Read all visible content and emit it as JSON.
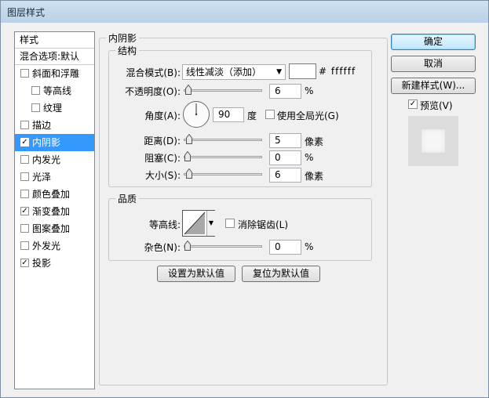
{
  "window": {
    "title": "图层样式"
  },
  "sidebar": {
    "header": "样式",
    "blend_options": "混合选项:默认",
    "items": [
      {
        "label": "斜面和浮雕",
        "checked": false,
        "indent": 0
      },
      {
        "label": "等高线",
        "checked": false,
        "indent": 1
      },
      {
        "label": "纹理",
        "checked": false,
        "indent": 1
      },
      {
        "label": "描边",
        "checked": false,
        "indent": 0
      },
      {
        "label": "内阴影",
        "checked": true,
        "indent": 0,
        "selected": true
      },
      {
        "label": "内发光",
        "checked": false,
        "indent": 0
      },
      {
        "label": "光泽",
        "checked": false,
        "indent": 0
      },
      {
        "label": "颜色叠加",
        "checked": false,
        "indent": 0
      },
      {
        "label": "渐变叠加",
        "checked": true,
        "indent": 0
      },
      {
        "label": "图案叠加",
        "checked": false,
        "indent": 0
      },
      {
        "label": "外发光",
        "checked": false,
        "indent": 0
      },
      {
        "label": "投影",
        "checked": true,
        "indent": 0
      }
    ]
  },
  "panel": {
    "title": "内阴影",
    "structure": {
      "title": "结构",
      "blend_mode_label": "混合模式(B):",
      "blend_mode_value": "线性减淡（添加）",
      "color_hex": "#ffffff",
      "color_text": "# ffffff",
      "opacity_label": "不透明度(O):",
      "opacity_value": "6",
      "opacity_unit": "%",
      "angle_label": "角度(A):",
      "angle_value": "90",
      "angle_unit": "度",
      "global_light_label": "使用全局光(G)",
      "global_light_checked": false,
      "distance_label": "距离(D):",
      "distance_value": "5",
      "distance_unit": "像素",
      "choke_label": "阻塞(C):",
      "choke_value": "0",
      "choke_unit": "%",
      "size_label": "大小(S):",
      "size_value": "6",
      "size_unit": "像素"
    },
    "quality": {
      "title": "品质",
      "contour_label": "等高线:",
      "antialias_label": "消除锯齿(L)",
      "antialias_checked": false,
      "noise_label": "杂色(N):",
      "noise_value": "0",
      "noise_unit": "%"
    },
    "set_default": "设置为默认值",
    "reset_default": "复位为默认值"
  },
  "buttons": {
    "ok": "确定",
    "cancel": "取消",
    "new_style": "新建样式(W)...",
    "preview_label": "预览(V)",
    "preview_checked": true
  }
}
